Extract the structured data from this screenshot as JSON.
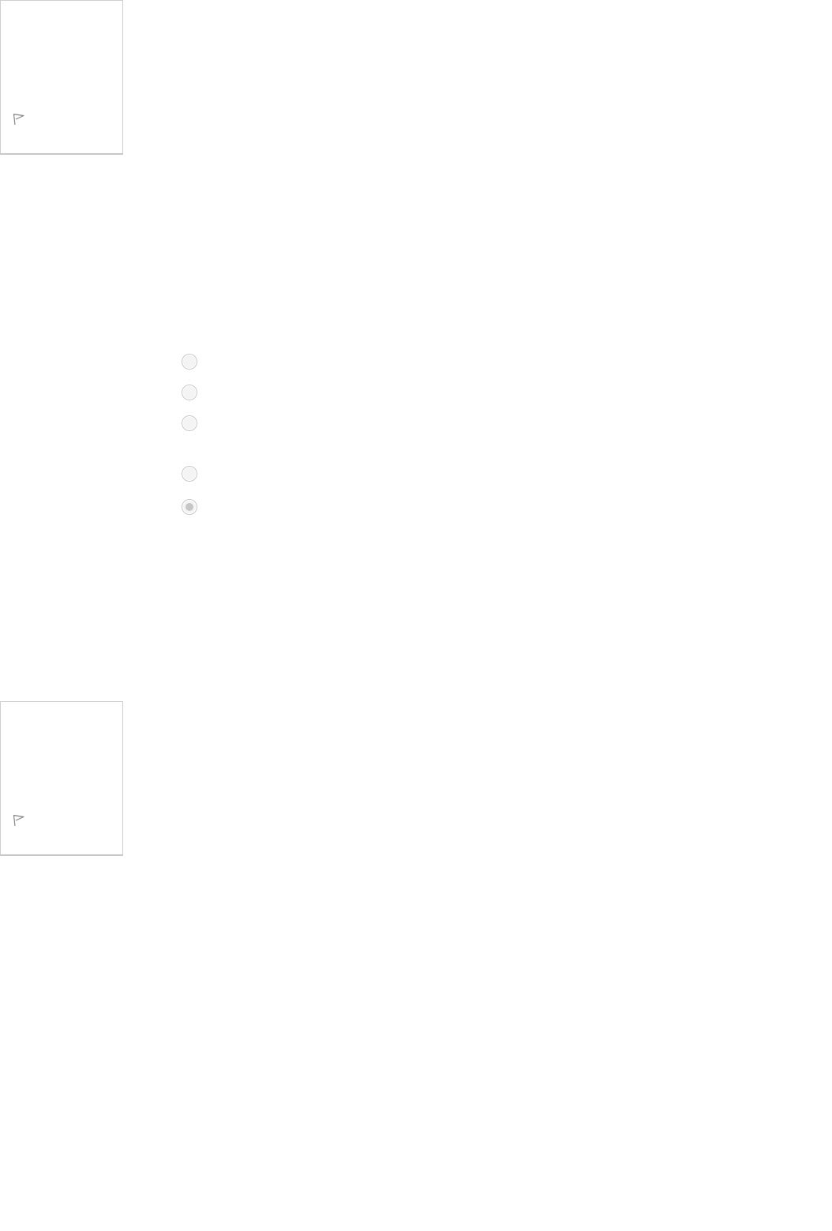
{
  "questions": [
    {
      "flag_icon": "flag-outline-icon",
      "flagged": false
    },
    {
      "flag_icon": "flag-outline-icon",
      "flagged": false
    }
  ],
  "answer_options": [
    {
      "checked": false
    },
    {
      "checked": false
    },
    {
      "checked": false
    },
    {
      "checked": false
    },
    {
      "checked": true
    }
  ],
  "colors": {
    "border": "#cfcfcf",
    "radio_fill": "#f4f4f4",
    "radio_dot": "#c6c6c6",
    "icon": "#8a8a8a"
  }
}
